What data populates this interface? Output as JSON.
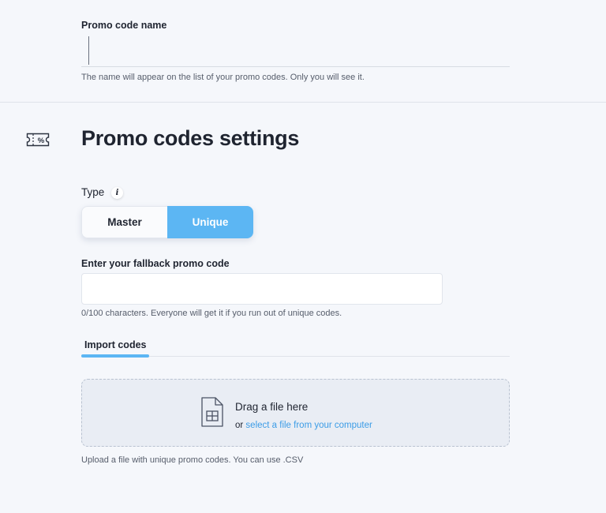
{
  "promo_name": {
    "label": "Promo code name",
    "value": "",
    "help": "The name will appear on the list of your promo codes. Only you will see it."
  },
  "settings": {
    "title": "Promo codes settings",
    "icon": "ticket-percent-icon",
    "type_label": "Type",
    "info_glyph": "i",
    "type_options": [
      "Master",
      "Unique"
    ],
    "type_selected": "Unique",
    "fallback_label": "Enter your fallback promo code",
    "fallback_value": "",
    "fallback_help": "0/100 characters. Everyone will get it if you run out of unique codes.",
    "tab_label": "Import codes",
    "drop_title": "Drag a file here",
    "drop_or": "or",
    "drop_link": "select a file from your computer",
    "upload_help": "Upload a file with unique promo codes. You can use .CSV"
  },
  "colors": {
    "accent": "#5cb6f3",
    "link": "#3b9ce6",
    "background": "#f5f7fb"
  }
}
